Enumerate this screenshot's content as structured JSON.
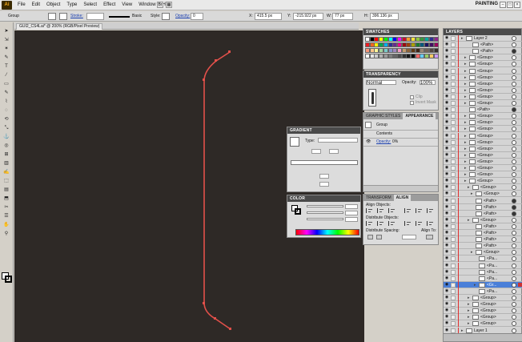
{
  "app": {
    "logo": "Ai",
    "workspace": "PAINTING"
  },
  "menu": [
    "File",
    "Edit",
    "Object",
    "Type",
    "Select",
    "Effect",
    "View",
    "Window",
    "Help"
  ],
  "controlbar": {
    "selection": "Group",
    "stroke_label": "Stroke:",
    "brush_label": "Basic",
    "style_label": "Style:",
    "opacity_label": "Opacity:",
    "opacity_value": "0",
    "x_label": "X:",
    "x_value": "415.5 px",
    "y_label": "Y:",
    "y_value": "-215.922 px",
    "w_label": "W:",
    "w_value": "77 px",
    "h_label": "H:",
    "h_value": "396.136 px"
  },
  "document": {
    "tab_title": "GUI2_CS4Lai* @ 200% (RGB/Pixel Preview)"
  },
  "panels": {
    "swatches_title": "SWATCHES",
    "transparency_title": "TRANSPARENCY",
    "transparency_mode": "Normal",
    "transparency_opacity_label": "Opacity:",
    "transparency_opacity": "100%",
    "clip_label": "Clip",
    "invert_mask_label": "Invert Mask",
    "graphic_styles_tab": "GRAPHIC STYLES",
    "appearance_tab": "APPEARANCE",
    "appearance_group": "Group",
    "appearance_contents": "Contents",
    "appearance_opacity_label": "Opacity:",
    "appearance_opacity_value": "0%",
    "gradient_title": "GRADIENT",
    "gradient_type_label": "Type:",
    "color_title": "COLOR",
    "transform_tab": "TRANSFORM",
    "align_tab": "ALIGN",
    "align_objects": "Align Objects:",
    "distribute_objects": "Distribute Objects:",
    "distribute_spacing": "Distribute Spacing:",
    "align_to": "Align To:"
  },
  "swatch_colors": [
    "#ffffff",
    "#000000",
    "#ff0000",
    "#ffff00",
    "#00ff00",
    "#00ffff",
    "#0000ff",
    "#ff00ff",
    "#c8102e",
    "#f29a2e",
    "#f7e43a",
    "#8dc63f",
    "#3a9a3c",
    "#00a99d",
    "#2e3192",
    "#92278f",
    "#ed1c24",
    "#f26522",
    "#fff200",
    "#00a651",
    "#00aeef",
    "#2e3192",
    "#662d91",
    "#ec008c",
    "#9e0b0f",
    "#a0410d",
    "#aba000",
    "#197b30",
    "#005b7f",
    "#1b1464",
    "#440e62",
    "#9e005d",
    "#f7977a",
    "#fdc689",
    "#fff799",
    "#a3d39c",
    "#7accc8",
    "#8393ca",
    "#a187be",
    "#f49ac2",
    "#c69c6d",
    "#8c6239",
    "#603913",
    "#3c2415",
    "#998675",
    "#736357",
    "#534741",
    "#362f2d",
    "#ffffff",
    "#e6e6e6",
    "#cccccc",
    "#b3b3b3",
    "#999999",
    "#808080",
    "#666666",
    "#4d4d4d",
    "#333333",
    "#1a1a1a",
    "#000000",
    "#ff6666",
    "#66ccff",
    "#99cc66",
    "#ffcc66",
    "#cc99ff"
  ],
  "layers": {
    "title": "LAYERS",
    "rows": [
      {
        "name": "Layer 2",
        "indent": 0,
        "target": "empty",
        "expanded": true
      },
      {
        "name": "<Path>",
        "indent": 2,
        "target": "empty"
      },
      {
        "name": "<Path>",
        "indent": 2,
        "target": "filled"
      },
      {
        "name": "<Group>",
        "indent": 1,
        "target": "empty"
      },
      {
        "name": "<Group>",
        "indent": 1,
        "target": "empty"
      },
      {
        "name": "<Group>",
        "indent": 1,
        "target": "empty"
      },
      {
        "name": "<Group>",
        "indent": 1,
        "target": "empty"
      },
      {
        "name": "<Group>",
        "indent": 1,
        "target": "empty"
      },
      {
        "name": "<Group>",
        "indent": 1,
        "target": "empty"
      },
      {
        "name": "<Group>",
        "indent": 1,
        "target": "empty"
      },
      {
        "name": "<Group>",
        "indent": 1,
        "target": "empty"
      },
      {
        "name": "<Path>",
        "indent": 1,
        "target": "filled"
      },
      {
        "name": "<Group>",
        "indent": 1,
        "target": "empty"
      },
      {
        "name": "<Group>",
        "indent": 1,
        "target": "empty"
      },
      {
        "name": "<Group>",
        "indent": 1,
        "target": "empty"
      },
      {
        "name": "<Group>",
        "indent": 1,
        "target": "empty"
      },
      {
        "name": "<Group>",
        "indent": 1,
        "target": "empty"
      },
      {
        "name": "<Group>",
        "indent": 1,
        "target": "empty"
      },
      {
        "name": "<Group>",
        "indent": 1,
        "target": "empty"
      },
      {
        "name": "<Group>",
        "indent": 1,
        "target": "empty"
      },
      {
        "name": "<Group>",
        "indent": 1,
        "target": "empty"
      },
      {
        "name": "<Group>",
        "indent": 1,
        "target": "empty"
      },
      {
        "name": "<Group>",
        "indent": 1,
        "target": "empty"
      },
      {
        "name": "<Group>",
        "indent": 2,
        "target": "empty"
      },
      {
        "name": "<Group>",
        "indent": 3,
        "target": "empty"
      },
      {
        "name": "<Path>",
        "indent": 3,
        "target": "filled"
      },
      {
        "name": "<Path>",
        "indent": 3,
        "target": "filled"
      },
      {
        "name": "<Path>",
        "indent": 3,
        "target": "filled"
      },
      {
        "name": "<Group>",
        "indent": 2,
        "target": "empty"
      },
      {
        "name": "<Path>",
        "indent": 3,
        "target": "empty"
      },
      {
        "name": "<Path>",
        "indent": 3,
        "target": "empty"
      },
      {
        "name": "<Path>",
        "indent": 3,
        "target": "empty"
      },
      {
        "name": "<Path>",
        "indent": 3,
        "target": "empty"
      },
      {
        "name": "<Group>",
        "indent": 3,
        "target": "empty"
      },
      {
        "name": "<Pa...",
        "indent": 4,
        "target": "empty"
      },
      {
        "name": "<Pa...",
        "indent": 4,
        "target": "empty"
      },
      {
        "name": "<Pa...",
        "indent": 4,
        "target": "empty"
      },
      {
        "name": "<Pa...",
        "indent": 4,
        "target": "empty"
      },
      {
        "name": "<Gr...",
        "indent": 4,
        "target": "empty",
        "selected": true
      },
      {
        "name": "<Pa...",
        "indent": 4,
        "target": "empty"
      },
      {
        "name": "<Group>",
        "indent": 2,
        "target": "empty"
      },
      {
        "name": "<Group>",
        "indent": 2,
        "target": "empty"
      },
      {
        "name": "<Group>",
        "indent": 2,
        "target": "empty"
      },
      {
        "name": "<Group>",
        "indent": 2,
        "target": "empty"
      },
      {
        "name": "<Group>",
        "indent": 2,
        "target": "empty"
      },
      {
        "name": "Layer 1",
        "indent": 0,
        "target": "empty"
      }
    ]
  },
  "colors": {
    "canvas_bg": "#2e2926",
    "path_stroke": "#e2504a",
    "selection_blue": "#4a7fd8"
  }
}
